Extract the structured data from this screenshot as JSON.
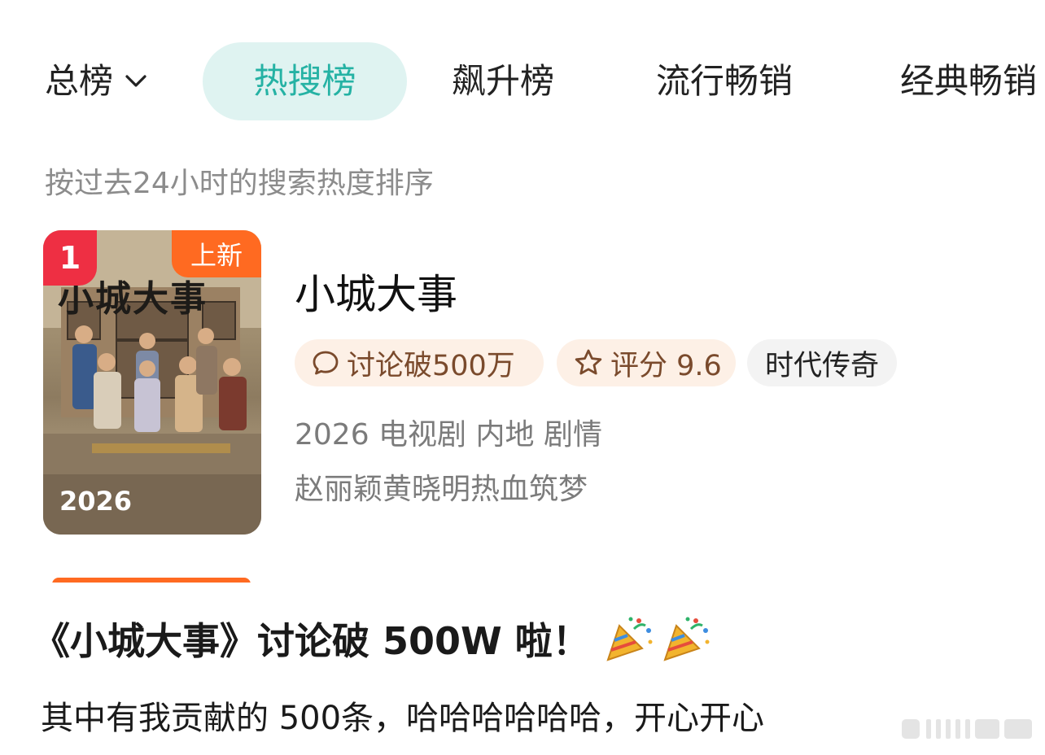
{
  "tabs": {
    "all_label": "总榜",
    "hot_search": "热搜榜",
    "rising": "飙升榜",
    "popular": "流行畅销",
    "classic": "经典畅销"
  },
  "subtitle": "按过去24小时的搜索热度排序",
  "item": {
    "rank": "1",
    "new_badge": "上新",
    "poster_title": "小城大事",
    "poster_year": "2026",
    "title": "小城大事",
    "tags": {
      "discussion": "讨论破500万",
      "rating": "评分 9.6",
      "genre": "时代传奇"
    },
    "info": "2026 电视剧 内地 剧情",
    "description": "赵丽颖黄晓明热血筑梦"
  },
  "post": {
    "title": "《小城大事》讨论破 500W 啦！",
    "body": "其中有我贡献的 500条，哈哈哈哈哈哈，开心开心"
  },
  "icons": {
    "dropdown": "chevron-down-icon",
    "discussion": "chat-bubble-icon",
    "rating": "star-outline-icon",
    "celebration": "party-popper-icon"
  },
  "colors": {
    "accent_teal": "#25b2a4",
    "rank_red": "#ee2f43",
    "new_orange": "#ff6a21",
    "tag_bg": "#fdf0e6"
  }
}
